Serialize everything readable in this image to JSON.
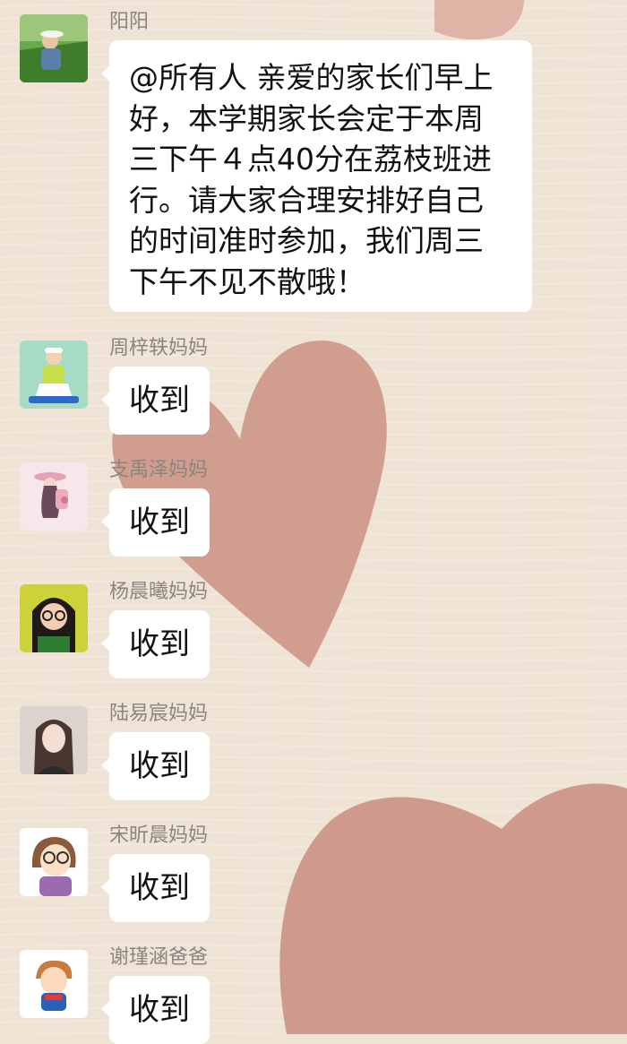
{
  "messages": [
    {
      "sender": "阳阳",
      "text": "@所有人 亲爱的家长们早上好，本学期家长会定于本周三下午４点40分在荔枝班进行。请大家合理安排好自己的时间准时参加，我们周三下午不见不散哦！",
      "avatar_icon": "child-in-field-avatar"
    },
    {
      "sender": "周梓轶妈妈",
      "text": "收到",
      "avatar_icon": "child-green-background-avatar"
    },
    {
      "sender": "支禹泽妈妈",
      "text": "收到",
      "avatar_icon": "girl-with-hat-illustration-avatar"
    },
    {
      "sender": "杨晨曦妈妈",
      "text": "收到",
      "avatar_icon": "woman-with-glasses-avatar"
    },
    {
      "sender": "陆易宸妈妈",
      "text": "收到",
      "avatar_icon": "woman-long-hair-avatar"
    },
    {
      "sender": "宋昕晨妈妈",
      "text": "收到",
      "avatar_icon": "cartoon-girl-glasses-avatar"
    },
    {
      "sender": "谢瑾涵爸爸",
      "text": "收到",
      "avatar_icon": "cartoon-boy-avatar"
    }
  ],
  "colors": {
    "background": "#efe3d6",
    "heart": "#c98d7e",
    "bubble": "#ffffff",
    "name_text": "#8a8580"
  }
}
